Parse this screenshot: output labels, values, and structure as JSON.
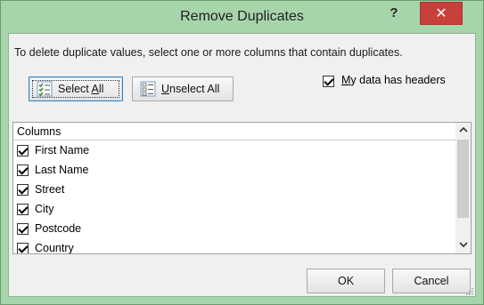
{
  "window": {
    "title": "Remove Duplicates",
    "help_label": "?",
    "close_label": "✕"
  },
  "dialog": {
    "instruction": "To delete duplicate values, select one or more columns that contain duplicates.",
    "select_all": {
      "pre": "Select ",
      "ul": "A",
      "post": "ll"
    },
    "unselect_all": {
      "ul": "U",
      "post": "nselect All"
    },
    "headers_checkbox": {
      "ul": "M",
      "post": "y data has headers",
      "checked": true
    }
  },
  "columns": {
    "header": "Columns",
    "items": [
      {
        "label": "First Name",
        "checked": true
      },
      {
        "label": "Last Name",
        "checked": true
      },
      {
        "label": "Street",
        "checked": true
      },
      {
        "label": "City",
        "checked": true
      },
      {
        "label": "Postcode",
        "checked": true
      },
      {
        "label": "Country",
        "checked": true
      }
    ],
    "scroll_up_icon": "chevron-up-icon",
    "scroll_down_icon": "chevron-down-icon"
  },
  "footer": {
    "ok_label": "OK",
    "cancel_label": "Cancel"
  },
  "colors": {
    "frame": "#a7d5ab",
    "close": "#c7403a",
    "client": "#f0f0f0"
  }
}
